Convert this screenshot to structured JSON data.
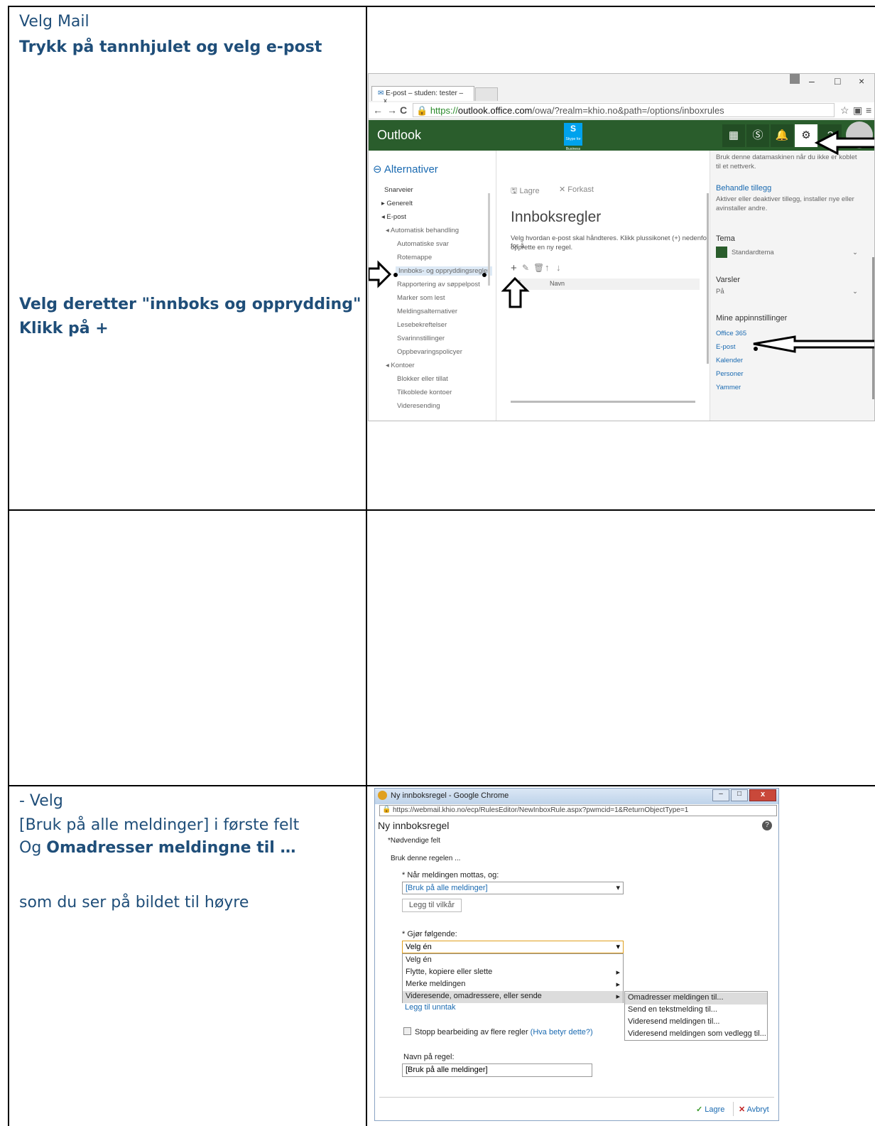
{
  "cells": {
    "r1_left": {
      "line1": "Velg Mail",
      "line2": "Trykk på tannhjulet og velg e-post",
      "line3": "Velg deretter \"innboks og opprydding\"",
      "line4": "Klikk på +"
    },
    "r3_left": {
      "line1": "- Velg",
      "line2": "[Bruk på alle meldinger] i første felt",
      "line3_prefix": "Og ",
      "line3_bold": "Omadresser meldingne til …",
      "line4": "som du ser på bildet til høyre"
    }
  },
  "ss1": {
    "tab_title": "E-post – studen: tester –",
    "tab_close": "x",
    "win_min": "–",
    "win_max": "□",
    "win_close": "×",
    "url_prefix": "https://",
    "url_domain": "outlook.office.com",
    "url_rest": "/owa/?realm=khio.no&path=/options/inboxrules",
    "app_name": "Outlook",
    "skype_label": "Skype for Business",
    "back_label": "Alternativer",
    "nav_items": [
      "Snarveier",
      "▸ Generelt",
      "◂ E-post",
      "◂ Automatisk behandling",
      "Automatiske svar",
      "Rotemappe",
      "Innboks- og oppryddingsregler",
      "Rapportering av søppelpost",
      "Marker som lest",
      "Meldingsalternativer",
      "Lesebekreftelser",
      "Svarinnstillinger",
      "Oppbevaringspolicyer",
      "◂ Kontoer",
      "Blokker eller tillat",
      "Tilkoblede kontoer",
      "Videresending"
    ],
    "save": "Lagre",
    "discard": "Forkast",
    "heading": "Innboksregler",
    "desc_line1": "Velg hvordan e-post skal håndteres. Klikk plussikonet (+) nedenfor for å",
    "desc_line2": "opprette en ny regel.",
    "col_on": "På",
    "col_name": "Navn",
    "right": {
      "top_line1": "Bruk denne datamaskinen når du ikke er koblet",
      "top_line2": "til et nettverk.",
      "addins_title": "Behandle tillegg",
      "addins_line1": "Aktiver eller deaktiver tillegg, installer nye eller",
      "addins_line2": "avinstaller andre.",
      "theme_title": "Tema",
      "theme_value": "Standardtema",
      "notif_title": "Varsler",
      "notif_value": "På",
      "apps_title": "Mine appinnstillinger",
      "apps": [
        "Office 365",
        "E-post",
        "Kalender",
        "Personer",
        "Yammer"
      ]
    }
  },
  "ss2": {
    "window_title": "Ny innboksregel - Google Chrome",
    "url": "https://webmail.khio.no/ecp/RulesEditor/NewInboxRule.aspx?pwmcid=1&ReturnObjectType=1",
    "heading": "Ny innboksregel",
    "help": "?",
    "required": "*Nødvendige felt",
    "apply": "Bruk denne regelen ...",
    "when_label": "* Når meldingen mottas, og:",
    "when_value": "[Bruk på alle meldinger]",
    "add_condition": "Legg til vilkår",
    "do_label": "* Gjør følgende:",
    "do_value": "Velg én",
    "menu": [
      "Velg én",
      "Flytte, kopiere eller slette",
      "Merke meldingen",
      "Videresende, omadressere, eller sende"
    ],
    "submenu": [
      "Omadresser meldingen til...",
      "Send en tekstmelding til...",
      "Videresend meldingen til...",
      "Videresend meldingen som vedlegg til..."
    ],
    "add_exception": "Legg til unntak",
    "stop_label": "Stopp bearbeiding av flere regler",
    "stop_link": "(Hva betyr dette?)",
    "name_label": "Navn på regel:",
    "name_value": "[Bruk på alle meldinger]",
    "save": "Lagre",
    "cancel": "Avbryt"
  }
}
